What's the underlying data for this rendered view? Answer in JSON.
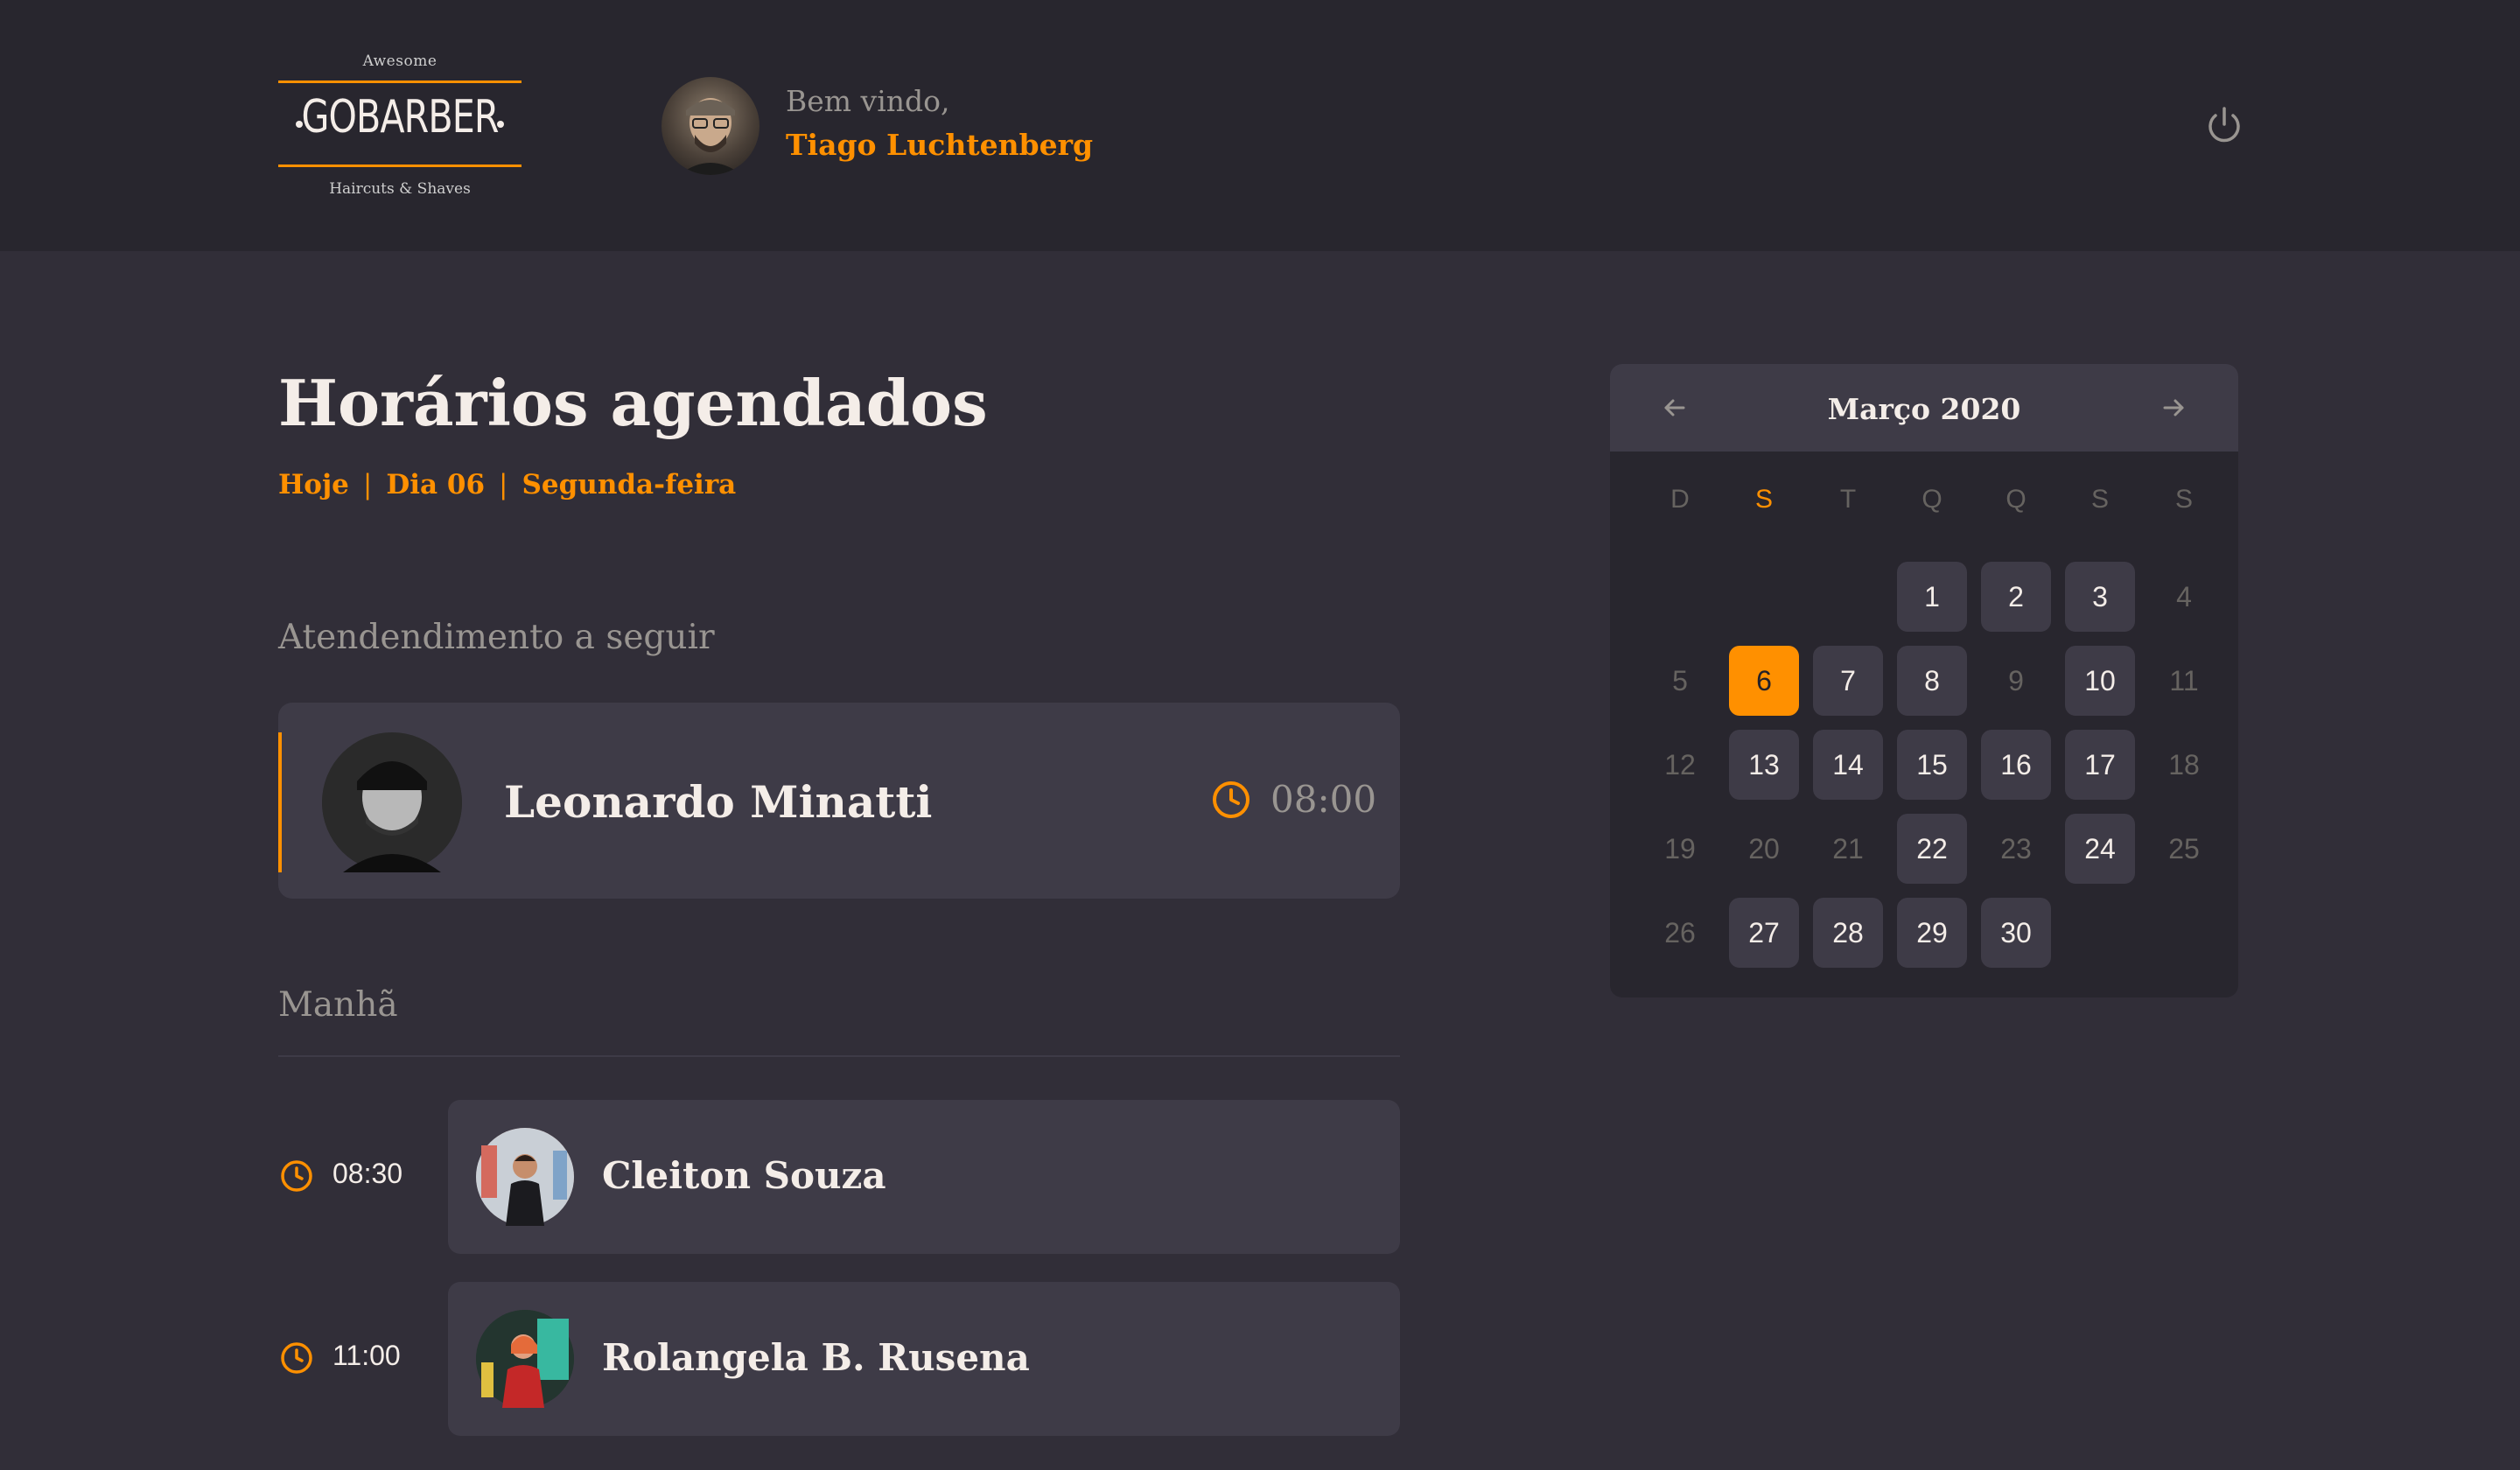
{
  "header": {
    "logo": {
      "top": "Awesome",
      "main": "GOBARBER",
      "bottom": "Haircuts & Shaves"
    },
    "welcome": "Bem vindo,",
    "user_name": "Tiago Luchtenberg",
    "icons": {
      "avatar": "user-avatar",
      "power": "power-icon"
    }
  },
  "main": {
    "title": "Horários agendados",
    "subtitle": {
      "today": "Hoje",
      "day": "Dia 06",
      "weekday": "Segunda-feira",
      "separator": "|"
    },
    "next_section": {
      "label": "Atendendimento a seguir",
      "name": "Leonardo Minatti",
      "time": "08:00"
    },
    "morning": {
      "label": "Manhã",
      "appointments": [
        {
          "time": "08:30",
          "name": "Cleiton Souza"
        },
        {
          "time": "11:00",
          "name": "Rolangela B. Rusena"
        }
      ]
    }
  },
  "calendar": {
    "month": "Março 2020",
    "weekdays": [
      "D",
      "S",
      "T",
      "Q",
      "Q",
      "S",
      "S"
    ],
    "selected_weekday_index": 1,
    "days": [
      {
        "d": "1",
        "s": "avail"
      },
      {
        "d": "2",
        "s": "avail"
      },
      {
        "d": "3",
        "s": "avail"
      },
      {
        "d": "4",
        "s": "disabled"
      },
      {
        "d": "5",
        "s": "disabled"
      },
      {
        "d": "6",
        "s": "selected"
      },
      {
        "d": "7",
        "s": "avail"
      },
      {
        "d": "8",
        "s": "avail"
      },
      {
        "d": "9",
        "s": "disabled"
      },
      {
        "d": "10",
        "s": "avail"
      },
      {
        "d": "11",
        "s": "disabled"
      },
      {
        "d": "12",
        "s": "disabled"
      },
      {
        "d": "13",
        "s": "avail"
      },
      {
        "d": "14",
        "s": "avail"
      },
      {
        "d": "15",
        "s": "avail"
      },
      {
        "d": "16",
        "s": "avail"
      },
      {
        "d": "17",
        "s": "avail"
      },
      {
        "d": "18",
        "s": "disabled"
      },
      {
        "d": "19",
        "s": "disabled"
      },
      {
        "d": "20",
        "s": "disabled"
      },
      {
        "d": "21",
        "s": "disabled"
      },
      {
        "d": "22",
        "s": "avail"
      },
      {
        "d": "23",
        "s": "disabled"
      },
      {
        "d": "24",
        "s": "avail"
      },
      {
        "d": "25",
        "s": "disabled"
      },
      {
        "d": "26",
        "s": "disabled"
      },
      {
        "d": "27",
        "s": "avail"
      },
      {
        "d": "28",
        "s": "avail"
      },
      {
        "d": "29",
        "s": "avail"
      },
      {
        "d": "30",
        "s": "avail"
      }
    ]
  },
  "colors": {
    "accent": "#ff9000",
    "background": "#312e38",
    "header": "#28262e",
    "card": "#3e3b47",
    "text": "#f4ede8",
    "muted": "#999591"
  }
}
